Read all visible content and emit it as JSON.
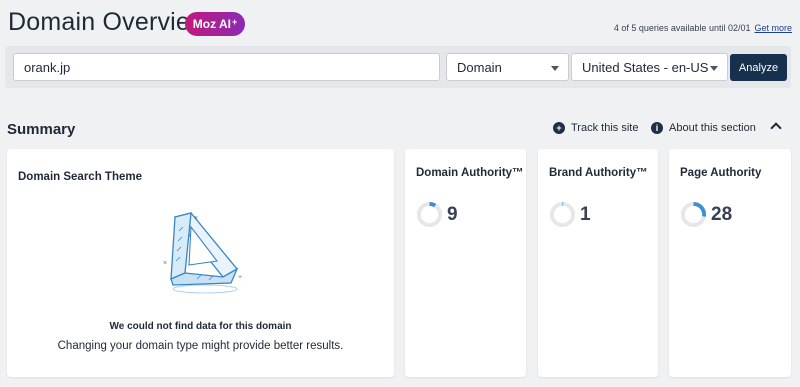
{
  "header": {
    "title": "Domain Overview",
    "badge_label": "Moz AI",
    "badge_spark": "+",
    "quota_text": "4 of 5 queries available until 02/01",
    "quota_link": "Get more"
  },
  "search": {
    "domain_value": "orank.jp",
    "type_value": "Domain",
    "country_value": "United States - en-US",
    "analyze_label": "Analyze"
  },
  "summary": {
    "title": "Summary",
    "track_label": "Track this site",
    "about_label": "About this section"
  },
  "theme_card": {
    "title": "Domain Search Theme",
    "empty_title": "We could not find data for this domain",
    "empty_subtitle": "Changing your domain type might provide better results."
  },
  "metrics": [
    {
      "title": "Domain Authority™",
      "value": "9",
      "fraction": 0.09
    },
    {
      "title": "Brand Authority™",
      "value": "1",
      "fraction": 0.01
    },
    {
      "title": "Page Authority",
      "value": "28",
      "fraction": 0.28
    }
  ],
  "colors": {
    "accent": "#16304d",
    "gauge_fill": "#3b8fd6",
    "gauge_track": "#e5e7eb",
    "badge_start": "#c2187a",
    "badge_end": "#8a2bb5"
  }
}
